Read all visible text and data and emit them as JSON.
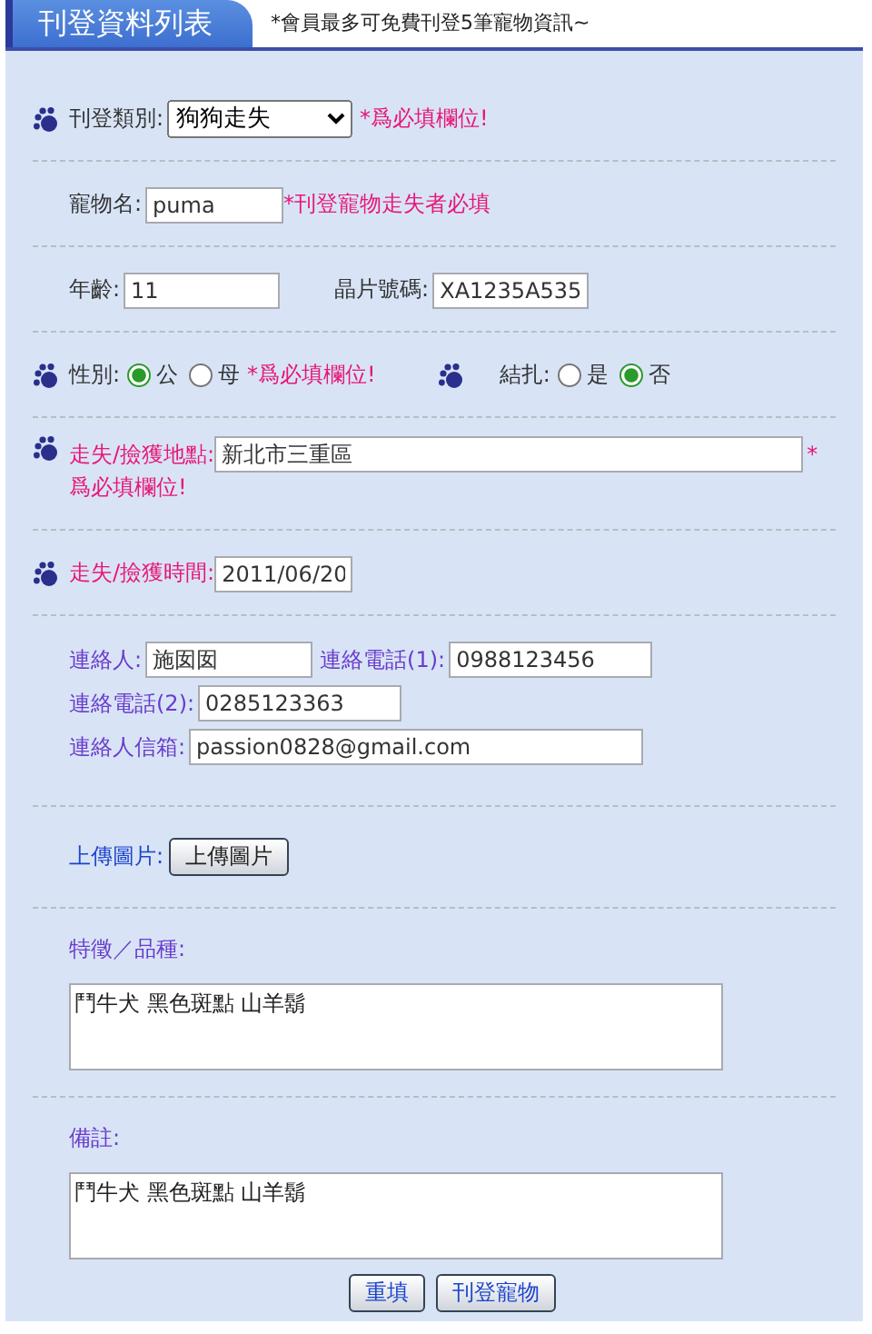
{
  "header": {
    "title": "刊登資料列表",
    "note": "*會員最多可免費刊登5筆寵物資訊~"
  },
  "category": {
    "label": "刊登類別:",
    "value": "狗狗走失",
    "required": "*爲必填欄位!"
  },
  "pet_name": {
    "label": "寵物名:",
    "value": "puma",
    "hint": "*刊登寵物走失者必填"
  },
  "age": {
    "label": "年齡:",
    "value": "11"
  },
  "chip": {
    "label": "晶片號碼:",
    "value": "XA1235A535"
  },
  "gender": {
    "label": "性別:",
    "options": [
      {
        "label": "公",
        "selected": true
      },
      {
        "label": "母",
        "selected": false
      }
    ],
    "required": "*爲必填欄位!"
  },
  "neutered": {
    "label": "結扎:",
    "options": [
      {
        "label": "是",
        "selected": false
      },
      {
        "label": "否",
        "selected": true
      }
    ]
  },
  "location": {
    "label": "走失/撿獲地點:",
    "value": "新北市三重區",
    "required_mark": "*",
    "required_note": "爲必填欄位!"
  },
  "lost_date": {
    "label": "走失/撿獲時間:",
    "value": "2011/06/20"
  },
  "contact": {
    "fields": [
      {
        "label": "連絡人:",
        "value": "施囡囡"
      },
      {
        "label": "連絡電話(1):",
        "value": "0988123456"
      },
      {
        "label": "連絡電話(2):",
        "value": "0285123363"
      },
      {
        "label": "連絡人信箱:",
        "value": "passion0828@gmail.com"
      }
    ]
  },
  "upload": {
    "label": "上傳圖片:",
    "button": "上傳圖片"
  },
  "features": {
    "label": "特徵／品種:",
    "value": "鬥牛犬 黑色斑點 山羊鬍"
  },
  "remarks": {
    "label": "備註:",
    "value": "鬥牛犬 黑色斑點 山羊鬍"
  },
  "buttons": [
    "重填",
    "刊登寵物"
  ]
}
